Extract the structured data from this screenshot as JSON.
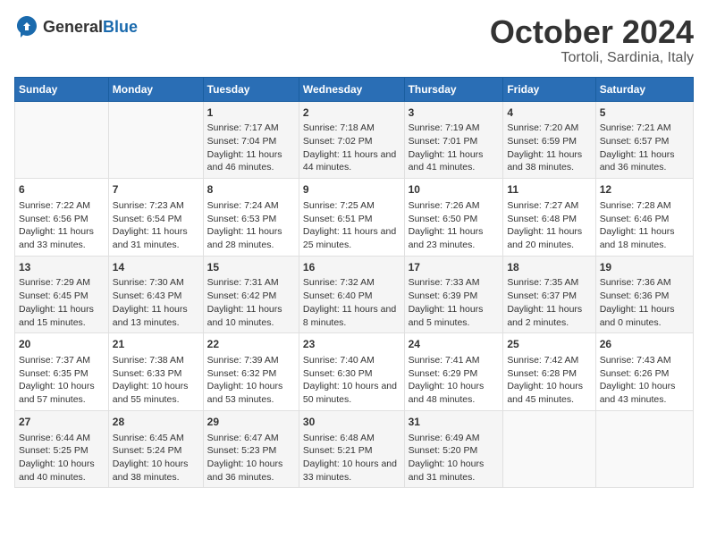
{
  "logo": {
    "general": "General",
    "blue": "Blue"
  },
  "title": "October 2024",
  "subtitle": "Tortoli, Sardinia, Italy",
  "days_of_week": [
    "Sunday",
    "Monday",
    "Tuesday",
    "Wednesday",
    "Thursday",
    "Friday",
    "Saturday"
  ],
  "weeks": [
    [
      {
        "day": "",
        "content": ""
      },
      {
        "day": "",
        "content": ""
      },
      {
        "day": "1",
        "content": "Sunrise: 7:17 AM\nSunset: 7:04 PM\nDaylight: 11 hours and 46 minutes."
      },
      {
        "day": "2",
        "content": "Sunrise: 7:18 AM\nSunset: 7:02 PM\nDaylight: 11 hours and 44 minutes."
      },
      {
        "day": "3",
        "content": "Sunrise: 7:19 AM\nSunset: 7:01 PM\nDaylight: 11 hours and 41 minutes."
      },
      {
        "day": "4",
        "content": "Sunrise: 7:20 AM\nSunset: 6:59 PM\nDaylight: 11 hours and 38 minutes."
      },
      {
        "day": "5",
        "content": "Sunrise: 7:21 AM\nSunset: 6:57 PM\nDaylight: 11 hours and 36 minutes."
      }
    ],
    [
      {
        "day": "6",
        "content": "Sunrise: 7:22 AM\nSunset: 6:56 PM\nDaylight: 11 hours and 33 minutes."
      },
      {
        "day": "7",
        "content": "Sunrise: 7:23 AM\nSunset: 6:54 PM\nDaylight: 11 hours and 31 minutes."
      },
      {
        "day": "8",
        "content": "Sunrise: 7:24 AM\nSunset: 6:53 PM\nDaylight: 11 hours and 28 minutes."
      },
      {
        "day": "9",
        "content": "Sunrise: 7:25 AM\nSunset: 6:51 PM\nDaylight: 11 hours and 25 minutes."
      },
      {
        "day": "10",
        "content": "Sunrise: 7:26 AM\nSunset: 6:50 PM\nDaylight: 11 hours and 23 minutes."
      },
      {
        "day": "11",
        "content": "Sunrise: 7:27 AM\nSunset: 6:48 PM\nDaylight: 11 hours and 20 minutes."
      },
      {
        "day": "12",
        "content": "Sunrise: 7:28 AM\nSunset: 6:46 PM\nDaylight: 11 hours and 18 minutes."
      }
    ],
    [
      {
        "day": "13",
        "content": "Sunrise: 7:29 AM\nSunset: 6:45 PM\nDaylight: 11 hours and 15 minutes."
      },
      {
        "day": "14",
        "content": "Sunrise: 7:30 AM\nSunset: 6:43 PM\nDaylight: 11 hours and 13 minutes."
      },
      {
        "day": "15",
        "content": "Sunrise: 7:31 AM\nSunset: 6:42 PM\nDaylight: 11 hours and 10 minutes."
      },
      {
        "day": "16",
        "content": "Sunrise: 7:32 AM\nSunset: 6:40 PM\nDaylight: 11 hours and 8 minutes."
      },
      {
        "day": "17",
        "content": "Sunrise: 7:33 AM\nSunset: 6:39 PM\nDaylight: 11 hours and 5 minutes."
      },
      {
        "day": "18",
        "content": "Sunrise: 7:35 AM\nSunset: 6:37 PM\nDaylight: 11 hours and 2 minutes."
      },
      {
        "day": "19",
        "content": "Sunrise: 7:36 AM\nSunset: 6:36 PM\nDaylight: 11 hours and 0 minutes."
      }
    ],
    [
      {
        "day": "20",
        "content": "Sunrise: 7:37 AM\nSunset: 6:35 PM\nDaylight: 10 hours and 57 minutes."
      },
      {
        "day": "21",
        "content": "Sunrise: 7:38 AM\nSunset: 6:33 PM\nDaylight: 10 hours and 55 minutes."
      },
      {
        "day": "22",
        "content": "Sunrise: 7:39 AM\nSunset: 6:32 PM\nDaylight: 10 hours and 53 minutes."
      },
      {
        "day": "23",
        "content": "Sunrise: 7:40 AM\nSunset: 6:30 PM\nDaylight: 10 hours and 50 minutes."
      },
      {
        "day": "24",
        "content": "Sunrise: 7:41 AM\nSunset: 6:29 PM\nDaylight: 10 hours and 48 minutes."
      },
      {
        "day": "25",
        "content": "Sunrise: 7:42 AM\nSunset: 6:28 PM\nDaylight: 10 hours and 45 minutes."
      },
      {
        "day": "26",
        "content": "Sunrise: 7:43 AM\nSunset: 6:26 PM\nDaylight: 10 hours and 43 minutes."
      }
    ],
    [
      {
        "day": "27",
        "content": "Sunrise: 6:44 AM\nSunset: 5:25 PM\nDaylight: 10 hours and 40 minutes."
      },
      {
        "day": "28",
        "content": "Sunrise: 6:45 AM\nSunset: 5:24 PM\nDaylight: 10 hours and 38 minutes."
      },
      {
        "day": "29",
        "content": "Sunrise: 6:47 AM\nSunset: 5:23 PM\nDaylight: 10 hours and 36 minutes."
      },
      {
        "day": "30",
        "content": "Sunrise: 6:48 AM\nSunset: 5:21 PM\nDaylight: 10 hours and 33 minutes."
      },
      {
        "day": "31",
        "content": "Sunrise: 6:49 AM\nSunset: 5:20 PM\nDaylight: 10 hours and 31 minutes."
      },
      {
        "day": "",
        "content": ""
      },
      {
        "day": "",
        "content": ""
      }
    ]
  ]
}
